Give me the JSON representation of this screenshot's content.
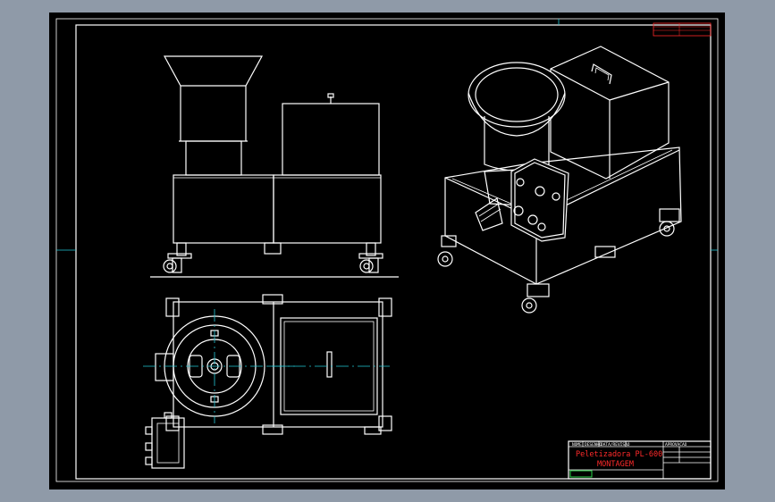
{
  "drawing": {
    "title_line1": "Peletizadora PL-600",
    "title_line2": "MONTAGEM",
    "title_block_headers": [
      "NOME",
      "DESENHO",
      "DATA/REVISAO",
      "APROVACAO"
    ],
    "title_color": "#ff2a2a",
    "background": "#000000",
    "outer_frame_color": "#8f9aa8",
    "line_color": "#ffffff",
    "centerline_color": "#22c7d6",
    "accent_green": "#2bd64a"
  },
  "views": {
    "front": "front-elevation-view",
    "top": "top-plan-view",
    "iso": "isometric-view"
  },
  "icons": {
    "caster": "caster-wheel-icon",
    "handle": "lid-handle-icon"
  }
}
